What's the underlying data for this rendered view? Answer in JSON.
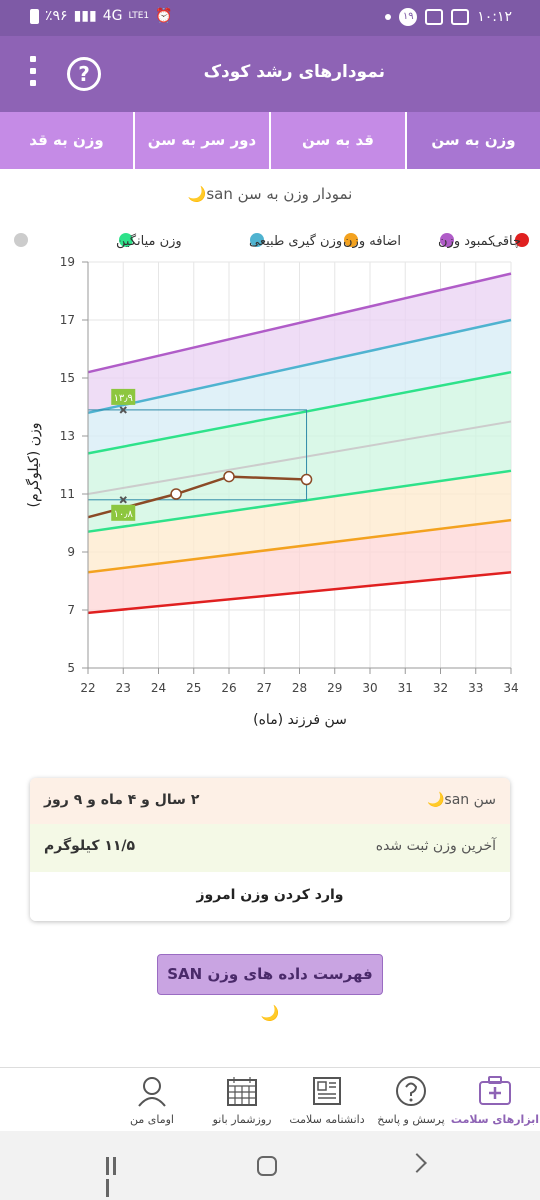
{
  "status_bar": {
    "left_text": "٪۹۶",
    "network": "4G",
    "lte": "LTE1",
    "time": "۱۰:۱۲",
    "notification_count": "۱۹"
  },
  "header": {
    "title": "نمودارهای رشد کودک",
    "help_label": "?"
  },
  "tabs": [
    {
      "label": "وزن به سن",
      "active": true
    },
    {
      "label": "قد به سن",
      "active": false
    },
    {
      "label": "دور سر به سن",
      "active": false
    },
    {
      "label": "وزن به قد",
      "active": false
    }
  ],
  "chart_title": "نمودار وزن به سن san🌙",
  "legend": [
    {
      "label": "چاقی",
      "color": "#b05cc8"
    },
    {
      "label": "اضافه وزن",
      "color": "#4fb3d0"
    },
    {
      "label": "وزن گیری طبیعی",
      "color": "#2ee28a"
    },
    {
      "label": "وزن میانگین",
      "color": "#cccccc"
    },
    {
      "label": "کمبود وزن",
      "color": "#f3a21f"
    }
  ],
  "legend_partial_color": "#e02020",
  "chart_data": {
    "type": "line",
    "xlabel": "سن فرزند (ماه)",
    "ylabel": "وزن (کیلوگرم)",
    "xlim": [
      22,
      34
    ],
    "ylim": [
      5,
      19
    ],
    "x_ticks": [
      22,
      23,
      24,
      25,
      26,
      27,
      28,
      29,
      30,
      31,
      32,
      33,
      34
    ],
    "y_ticks": [
      5,
      7,
      9,
      11,
      13,
      15,
      17,
      19
    ],
    "reference_lines": [
      {
        "name": "چاقی",
        "color": "#b05cc8",
        "points": [
          [
            22,
            15.2
          ],
          [
            34,
            18.6
          ]
        ]
      },
      {
        "name": "اضافه وزن",
        "color": "#4fb3d0",
        "points": [
          [
            22,
            13.8
          ],
          [
            34,
            17.0
          ]
        ]
      },
      {
        "name": "وزن گیری طبیعی",
        "color": "#2ee28a",
        "points": [
          [
            22,
            12.4
          ],
          [
            34,
            15.2
          ]
        ]
      },
      {
        "name": "وزن میانگین",
        "color": "#cccccc",
        "points": [
          [
            22,
            11.0
          ],
          [
            34,
            13.5
          ]
        ]
      },
      {
        "name": "وزن گیری طبیعی",
        "color": "#2ee28a",
        "points": [
          [
            22,
            9.7
          ],
          [
            34,
            11.8
          ]
        ]
      },
      {
        "name": "کمبود وزن",
        "color": "#f3a21f",
        "points": [
          [
            22,
            8.3
          ],
          [
            34,
            10.1
          ]
        ]
      },
      {
        "name": "",
        "color": "#e02020",
        "points": [
          [
            22,
            6.9
          ],
          [
            34,
            8.3
          ]
        ]
      }
    ],
    "child_series": {
      "color": "#8b4a26",
      "points": [
        [
          22,
          10.2
        ],
        [
          24.5,
          11.0
        ],
        [
          26,
          11.6
        ],
        [
          28.2,
          11.5
        ]
      ],
      "markers": [
        [
          24.5,
          11.0
        ],
        [
          26,
          11.6
        ],
        [
          28.2,
          11.5
        ]
      ]
    },
    "guide_marks": [
      {
        "x": 23,
        "y": 13.9,
        "label": "۱۳٫۹"
      },
      {
        "x": 23,
        "y": 10.8,
        "label": "۱۰٫۸"
      }
    ],
    "guide_box": {
      "x0": 22,
      "x1": 28.2,
      "y0": 10.8,
      "y1": 13.9
    }
  },
  "info_card": {
    "age_label": "سن san🌙",
    "age_value": "۲ سال و ۴ ماه و ۹ روز",
    "weight_label": "آخرین وزن ثبت شده",
    "weight_value": "۱۱/۵ کیلوگرم",
    "enter_weight": "وارد کردن وزن امروز"
  },
  "list_button": "فهرست داده های وزن SAN🌙",
  "bottom_nav": [
    {
      "label": "ابزارهای سلامت",
      "icon": "medical-kit-icon",
      "active": true
    },
    {
      "label": "پرسش و پاسخ",
      "icon": "question-icon",
      "active": false
    },
    {
      "label": "دانشنامه سلامت",
      "icon": "newspaper-icon",
      "active": false
    },
    {
      "label": "روزشمار بانو",
      "icon": "calendar-icon",
      "active": false
    },
    {
      "label": "اومای من",
      "icon": "person-icon",
      "active": false
    }
  ]
}
